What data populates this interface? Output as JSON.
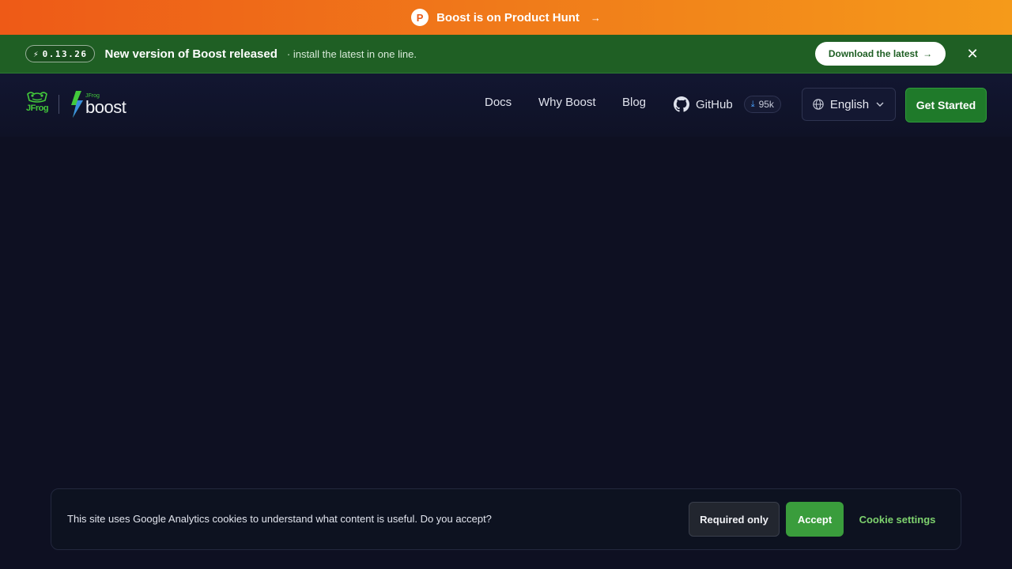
{
  "product_hunt": {
    "logo_letter": "P",
    "text": "Boost is on Product Hunt",
    "arrow": "→"
  },
  "release_bar": {
    "version_icon": "⚡",
    "version": "0.13.26",
    "title": "New version of Boost released",
    "subtitle": "· install the latest in one line.",
    "download_label": "Download the latest",
    "download_arrow": "→",
    "close_glyph": "✕"
  },
  "header": {
    "jfrog_text": "JFrog",
    "boost_small": "JFrog",
    "boost_word": "boost",
    "nav": {
      "docs": "Docs",
      "why_boost": "Why Boost",
      "blog": "Blog"
    },
    "github": {
      "label": "GitHub",
      "downloads_icon": "⤓",
      "count": "95k"
    },
    "language": {
      "selected": "English",
      "chevron": "⌄"
    },
    "get_started": "Get Started"
  },
  "cookie_banner": {
    "text": "This site uses Google Analytics cookies to understand what content is useful. Do you accept?",
    "required_only": "Required only",
    "accept": "Accept",
    "settings": "Cookie settings"
  },
  "colors": {
    "ph_orange_start": "#ee5a17",
    "ph_orange_end": "#f59a1a",
    "release_green": "#1f5f24",
    "page_bg": "#0e1022",
    "cta_green": "#1f7a2a",
    "accept_green": "#3a9d3c",
    "link_green": "#7ed26e"
  }
}
